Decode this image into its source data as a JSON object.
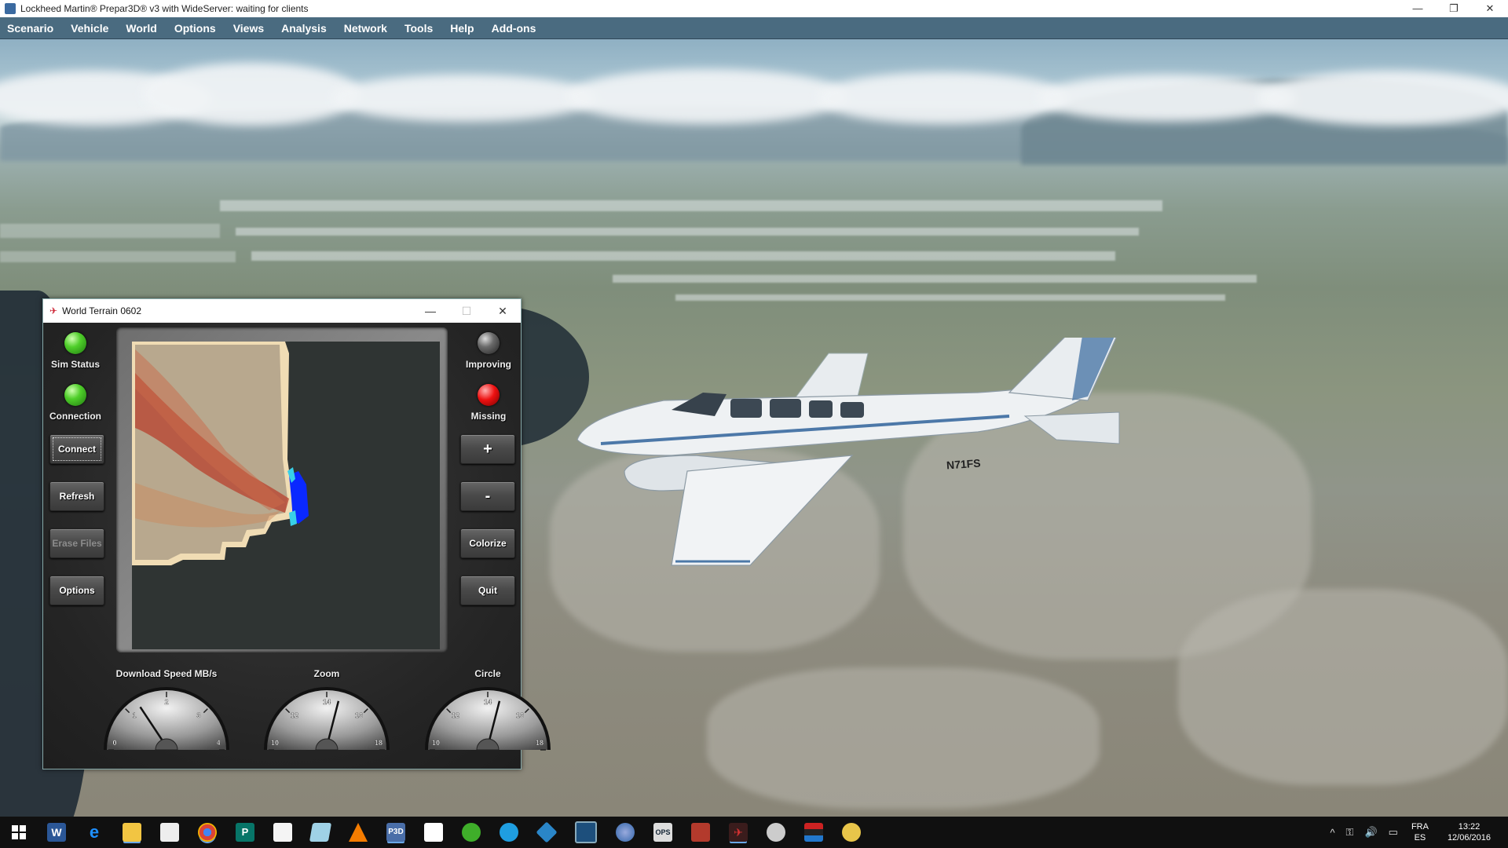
{
  "window": {
    "title": "Lockheed Martin® Prepar3D® v3 with WideServer: waiting for clients",
    "minimize": "—",
    "restore": "❐",
    "close": "✕"
  },
  "menu": [
    "Scenario",
    "Vehicle",
    "World",
    "Options",
    "Views",
    "Analysis",
    "Network",
    "Tools",
    "Help",
    "Add-ons"
  ],
  "aircraft": {
    "tail_number": "N71FS"
  },
  "terrain_window": {
    "title": "World Terrain 0602",
    "icon": "✈",
    "minimize": "—",
    "maximize": "☐",
    "close": "✕",
    "indicators": {
      "sim_status": "Sim Status",
      "connection": "Connection",
      "improving": "Improving",
      "missing": "Missing"
    },
    "indicator_colors": {
      "sim_status": "#4fcf2a",
      "connection": "#4fcf2a",
      "improving": "#6a6a6a",
      "missing": "#e11111"
    },
    "buttons": {
      "connect": "Connect",
      "refresh": "Refresh",
      "erase_files": "Erase Files",
      "options": "Options",
      "plus": "+",
      "minus": "-",
      "colorize": "Colorize",
      "quit": "Quit"
    },
    "gauges": [
      {
        "title": "Download Speed MB/s",
        "ticks": [
          "0",
          "1",
          "2",
          "3",
          "4"
        ],
        "value": 1.3,
        "min": 0,
        "max": 4
      },
      {
        "title": "Zoom",
        "ticks": [
          "10",
          "12",
          "14",
          "16",
          "18"
        ],
        "value": 14.6,
        "min": 10,
        "max": 18
      },
      {
        "title": "Circle",
        "ticks": [
          "10",
          "12",
          "14",
          "16",
          "18"
        ],
        "value": 14.6,
        "min": 10,
        "max": 18
      }
    ]
  },
  "taskbar": {
    "icons": [
      "windows-start-icon",
      "word-icon",
      "edge-icon",
      "file-explorer-icon",
      "store-icon",
      "chrome-icon",
      "publisher-icon",
      "document-icon",
      "notepad-icon",
      "vlc-icon",
      "p3d-icon",
      "blank-document-icon",
      "green-app-icon",
      "blue-sync-icon",
      "diamond-app-icon",
      "monitor-icon",
      "globe-icon",
      "ops-icon",
      "red-box-icon",
      "airplane-app-icon",
      "disc-icon",
      "flag-icon",
      "paint-icon"
    ],
    "p3d_label": "P3D",
    "ops_label": "OPS",
    "tray": {
      "chevron": "^",
      "network": "⚿",
      "volume": "🔊",
      "notifications": "▭",
      "language": "FRA",
      "layout": "ES",
      "time": "13:22",
      "date": "12/06/2016"
    }
  }
}
